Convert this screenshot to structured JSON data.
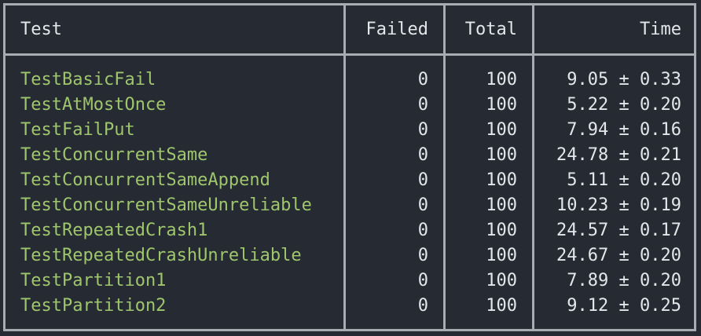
{
  "table": {
    "columns": {
      "test": "Test",
      "failed": "Failed",
      "total": "Total",
      "time": "Time"
    },
    "rows": [
      {
        "test": "TestBasicFail",
        "failed": "0",
        "total": "100",
        "time": "9.05 ± 0.33"
      },
      {
        "test": "TestAtMostOnce",
        "failed": "0",
        "total": "100",
        "time": "5.22 ± 0.20"
      },
      {
        "test": "TestFailPut",
        "failed": "0",
        "total": "100",
        "time": "7.94 ± 0.16"
      },
      {
        "test": "TestConcurrentSame",
        "failed": "0",
        "total": "100",
        "time": "24.78 ± 0.21"
      },
      {
        "test": "TestConcurrentSameAppend",
        "failed": "0",
        "total": "100",
        "time": "5.11 ± 0.20"
      },
      {
        "test": "TestConcurrentSameUnreliable",
        "failed": "0",
        "total": "100",
        "time": "10.23 ± 0.19"
      },
      {
        "test": "TestRepeatedCrash1",
        "failed": "0",
        "total": "100",
        "time": "24.57 ± 0.17"
      },
      {
        "test": "TestRepeatedCrashUnreliable",
        "failed": "0",
        "total": "100",
        "time": "24.67 ± 0.20"
      },
      {
        "test": "TestPartition1",
        "failed": "0",
        "total": "100",
        "time": "7.89 ± 0.20"
      },
      {
        "test": "TestPartition2",
        "failed": "0",
        "total": "100",
        "time": "9.12 ± 0.25"
      }
    ]
  },
  "colors": {
    "background": "#262a33",
    "border": "#a7acb3",
    "text": "#e4e6ea",
    "test_name": "#9fc66c"
  }
}
